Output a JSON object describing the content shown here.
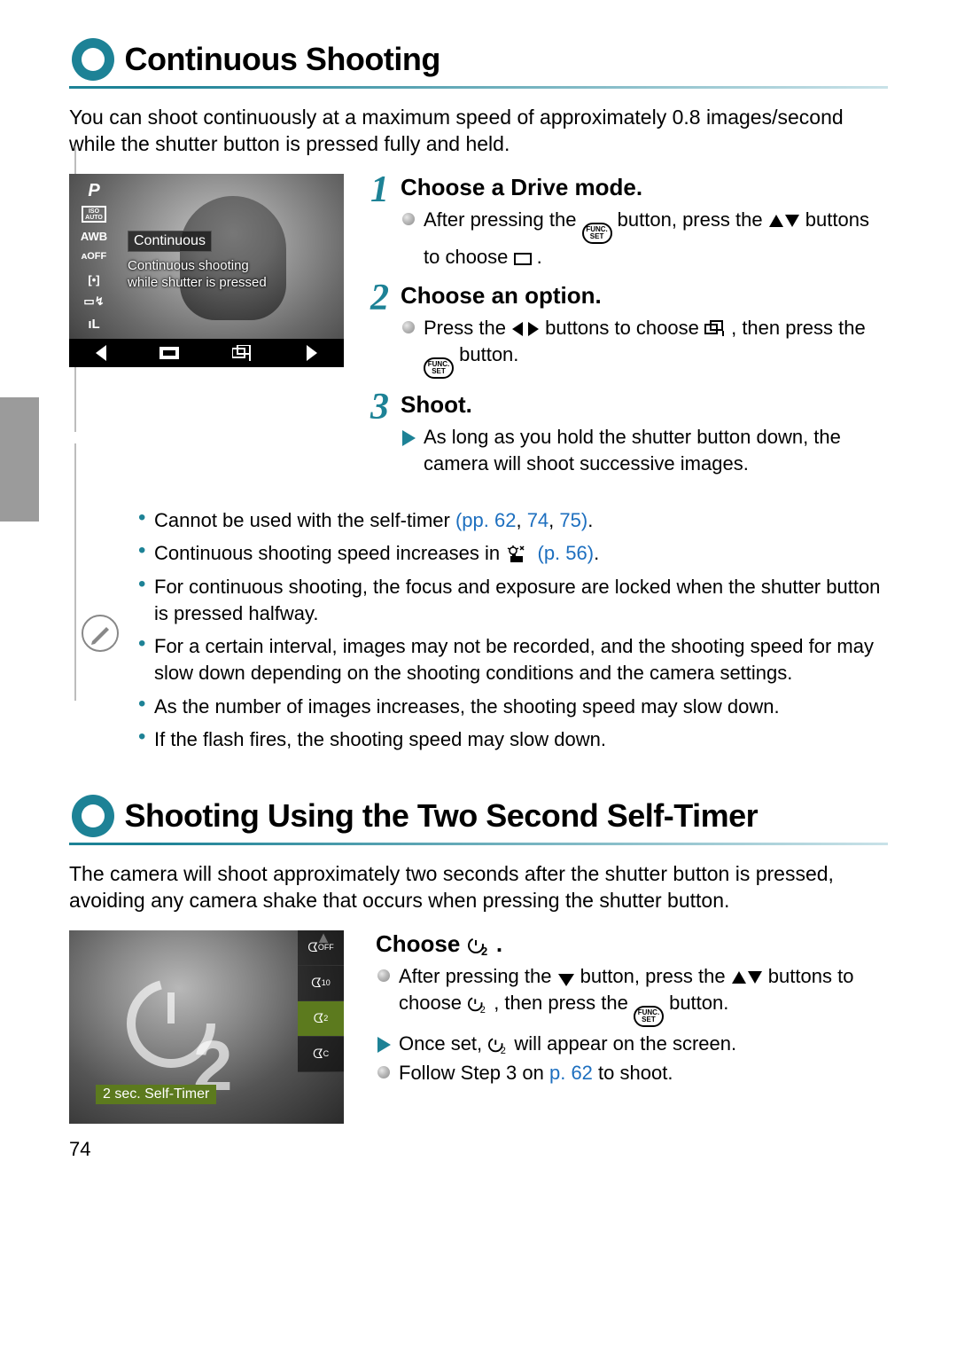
{
  "section1": {
    "title": "Continuous Shooting",
    "intro": "You can shoot continuously at a maximum speed of approximately 0.8 images/second while the shutter button is pressed fully and held.",
    "lcd": {
      "side": [
        "P",
        "ISO AUTO",
        "AWB",
        "Off",
        "[•]",
        "▭ᵢ",
        "ıL"
      ],
      "menu_title": "Continuous",
      "menu_desc_l1": "Continuous shooting",
      "menu_desc_l2": "while shutter is pressed"
    },
    "steps": [
      {
        "num": "1",
        "title": "Choose a Drive mode.",
        "lines": [
          {
            "type": "dot",
            "pre": "After pressing the ",
            "mid1": "func",
            "mid2": " button, press the ",
            "mid3": "updown",
            "post": " buttons to choose ",
            "tail": "square",
            "end": " ."
          }
        ]
      },
      {
        "num": "2",
        "title": "Choose an option.",
        "lines": [
          {
            "type": "dot",
            "pre": "Press the ",
            "mid1": "leftright",
            "mid2": " buttons to choose ",
            "mid3": "burst",
            "post": ", then press the ",
            "tail": "func",
            "end": " button."
          }
        ]
      },
      {
        "num": "3",
        "title": "Shoot.",
        "lines": [
          {
            "type": "arrow",
            "text": "As long as you hold the shutter button down, the camera will shoot successive images."
          }
        ]
      }
    ],
    "notes": [
      {
        "pre": "Cannot be used with the self-timer ",
        "links": [
          "(pp. 62",
          "74",
          "75)"
        ],
        "post": "."
      },
      {
        "pre": "Continuous shooting speed increases in ",
        "icon": "lowlight",
        "links": [
          "(p. 56)"
        ],
        "post": "."
      },
      {
        "text": "For continuous shooting, the focus and exposure are locked when the shutter button is pressed halfway."
      },
      {
        "text": "For a certain interval, images may not be recorded, and the shooting speed for may slow down depending on the shooting conditions and the camera settings."
      },
      {
        "text": "As the number of images increases, the shooting speed may slow down."
      },
      {
        "text": "If the flash fires, the shooting speed may slow down."
      }
    ]
  },
  "section2": {
    "title": "Shooting Using the Two Second Self-Timer",
    "intro": "The camera will shoot approximately two seconds after the shutter button is pressed, avoiding any camera shake that occurs when pressing the shutter button.",
    "lcd": {
      "menu": [
        "Off",
        "10",
        "2",
        "C"
      ],
      "selected_index": 2,
      "label": "2 sec. Self-Timer"
    },
    "step": {
      "title_pre": "Choose ",
      "title_icon": "timer2",
      "title_post": ".",
      "lines": [
        {
          "type": "dot",
          "pre": "After pressing the ",
          "i1": "down",
          "t1": " button, press the ",
          "i2": "updown",
          "t2": " buttons to choose ",
          "i3": "timer2",
          "t3": ", then press the ",
          "i4": "func",
          "t4": " button."
        },
        {
          "type": "arrow",
          "pre": "Once set, ",
          "i1": "timer2",
          "t1": " will appear on the screen."
        },
        {
          "type": "dot",
          "pre": "Follow Step 3 on ",
          "link": "p. 62",
          "post": " to shoot."
        }
      ]
    }
  },
  "page_number": "74"
}
